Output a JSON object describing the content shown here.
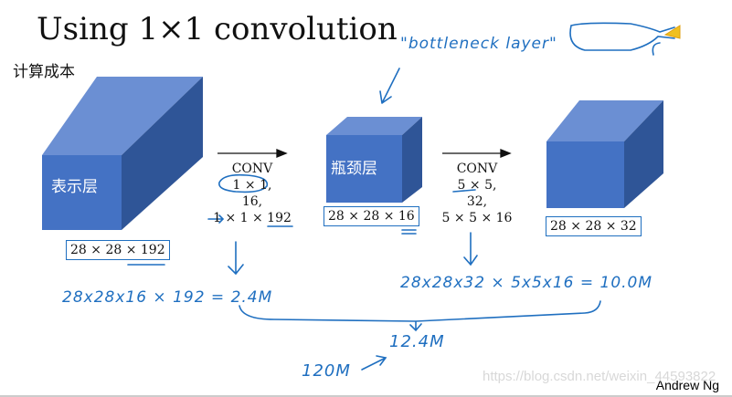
{
  "title": "Using 1×1 convolution",
  "subtitle": "计算成本",
  "colors": {
    "front": "#4472c4",
    "top": "#6b8fd3",
    "side": "#2f5597",
    "ink": "#1f6fc0",
    "highlight": "#f0c020"
  },
  "blocks": [
    {
      "label": "表示层",
      "dims": "28 × 28 × 192"
    },
    {
      "label": "瓶颈层",
      "dims": "28 × 28 × 16"
    },
    {
      "label": "",
      "dims": "28 × 28 × 32"
    }
  ],
  "conv1": {
    "name": "CONV",
    "kernel": "1 × 1,",
    "filters": "16,",
    "shape": "1 × 1 × 192"
  },
  "conv2": {
    "name": "CONV",
    "kernel": "5 × 5,",
    "filters": "32,",
    "shape": "5 × 5 × 16"
  },
  "handwriting": {
    "bottleneck": "\"bottleneck layer\"",
    "cost1": "28x28x16 × 192 = 2.4M",
    "cost2": "28x28x32 × 5x5x16 = 10.0M",
    "total": "12.4M",
    "compare": "120M"
  },
  "watermark": "https://blog.csdn.net/weixin_44593822",
  "author": "Andrew Ng"
}
